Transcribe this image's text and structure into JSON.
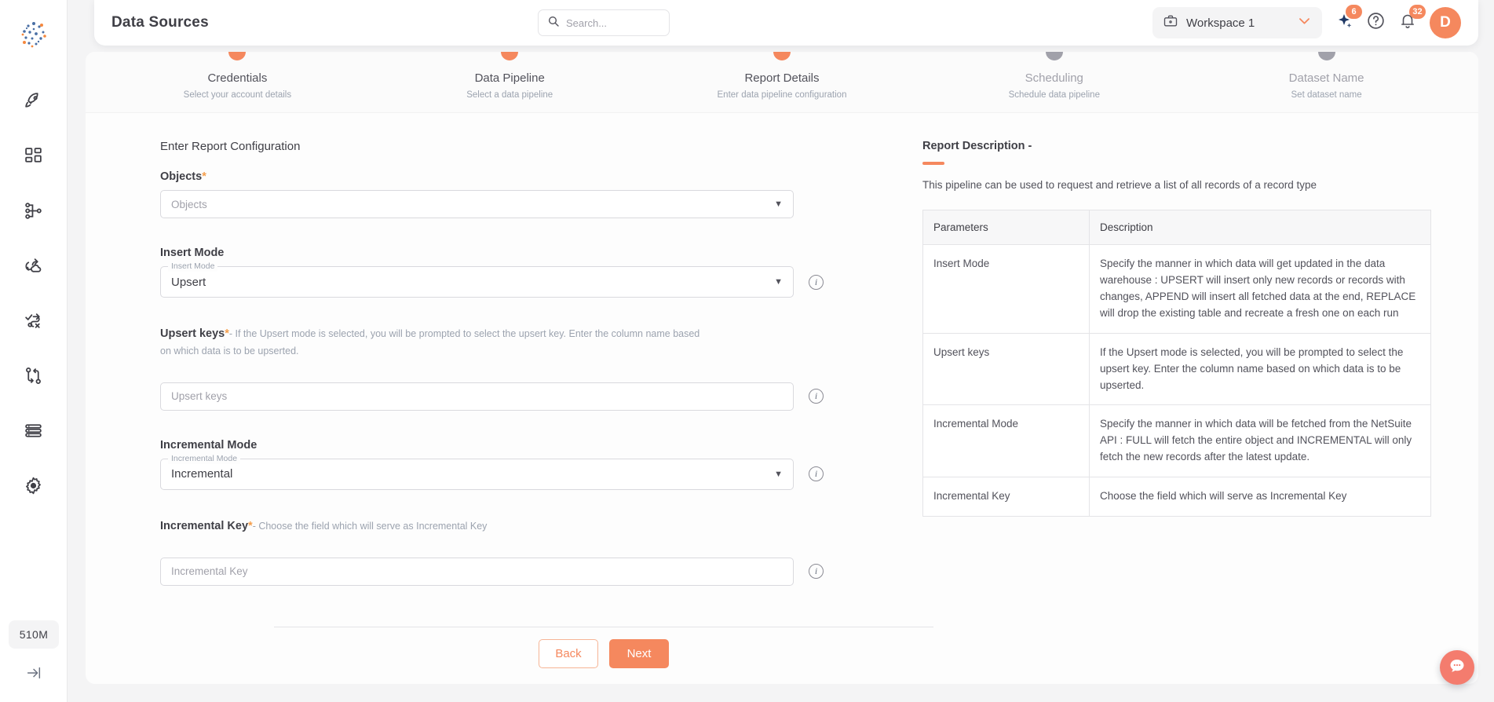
{
  "sidebar": {
    "logo_name": "platform-logo",
    "items": [
      {
        "name": "rocket-icon",
        "label": "Launch"
      },
      {
        "name": "grid-icon",
        "label": "Dashboard"
      },
      {
        "name": "network-nodes-icon",
        "label": "Data Sources"
      },
      {
        "name": "cloud-sync-icon",
        "label": "Sync"
      },
      {
        "name": "workflow-cancel-icon",
        "label": "Workflows"
      },
      {
        "name": "git-branch-icon",
        "label": "Branches"
      },
      {
        "name": "list-icon",
        "label": "Logs"
      },
      {
        "name": "gear-icon",
        "label": "Settings"
      }
    ],
    "usage_badge": "510M",
    "collapse_label": "Collapse sidebar"
  },
  "header": {
    "title": "Data Sources",
    "search_placeholder": "Search...",
    "search_value": "",
    "workspace": "Workspace 1",
    "sparkle_badge": "6",
    "help_label": "Help",
    "notifications_badge": "32",
    "avatar_initial": "D"
  },
  "stepper": {
    "steps": [
      {
        "title": "Credentials",
        "subtitle": "Select your account details",
        "state": "active"
      },
      {
        "title": "Data Pipeline",
        "subtitle": "Select a data pipeline",
        "state": "active"
      },
      {
        "title": "Report Details",
        "subtitle": "Enter data pipeline configuration",
        "state": "active"
      },
      {
        "title": "Scheduling",
        "subtitle": "Schedule data pipeline",
        "state": "inactive"
      },
      {
        "title": "Dataset Name",
        "subtitle": "Set dataset name",
        "state": "inactive"
      }
    ]
  },
  "form": {
    "section_title": "Enter Report Configuration",
    "objects": {
      "label": "Objects",
      "required": "*",
      "placeholder": "Objects",
      "value": ""
    },
    "insert_mode": {
      "label": "Insert Mode",
      "notch": "Insert Mode",
      "value": "Upsert"
    },
    "upsert_keys": {
      "label": "Upsert keys",
      "required": "*",
      "hint": "- If the Upsert mode is selected, you will be prompted to select the upsert key. Enter the column name based on which data is to be upserted.",
      "placeholder": "Upsert keys",
      "value": ""
    },
    "incremental_mode": {
      "label": "Incremental Mode",
      "notch": "Incremental Mode",
      "value": "Incremental"
    },
    "incremental_key": {
      "label": "Incremental Key",
      "required": "*",
      "hint": "- Choose the field which will serve as Incremental Key",
      "placeholder": "Incremental Key",
      "value": ""
    }
  },
  "report_description": {
    "title": "Report Description -",
    "description": "This pipeline can be used to request and retrieve a list of all records of a record type",
    "table": {
      "headers": [
        "Parameters",
        "Description"
      ],
      "rows": [
        {
          "parameter": "Insert Mode",
          "description": "Specify the manner in which data will get updated in the data warehouse : UPSERT will insert only new records or records with changes, APPEND will insert all fetched data at the end, REPLACE will drop the existing table and recreate a fresh one on each run"
        },
        {
          "parameter": "Upsert keys",
          "description": "If the Upsert mode is selected, you will be prompted to select the upsert key. Enter the column name based on which data is to be upserted."
        },
        {
          "parameter": "Incremental Mode",
          "description": "Specify the manner in which data will be fetched from the NetSuite API : FULL will fetch the entire object and INCREMENTAL will only fetch the new records after the latest update."
        },
        {
          "parameter": "Incremental Key",
          "description": "Choose the field which will serve as Incremental Key"
        }
      ]
    }
  },
  "footer": {
    "back_label": "Back",
    "next_label": "Next"
  },
  "chat": {
    "label": "Chat support"
  },
  "colors": {
    "accent": "#f5885e",
    "accent_chat": "#f47c6e",
    "required": "#f59e4b",
    "text": "#3f3f46",
    "muted": "#9ca3af"
  }
}
